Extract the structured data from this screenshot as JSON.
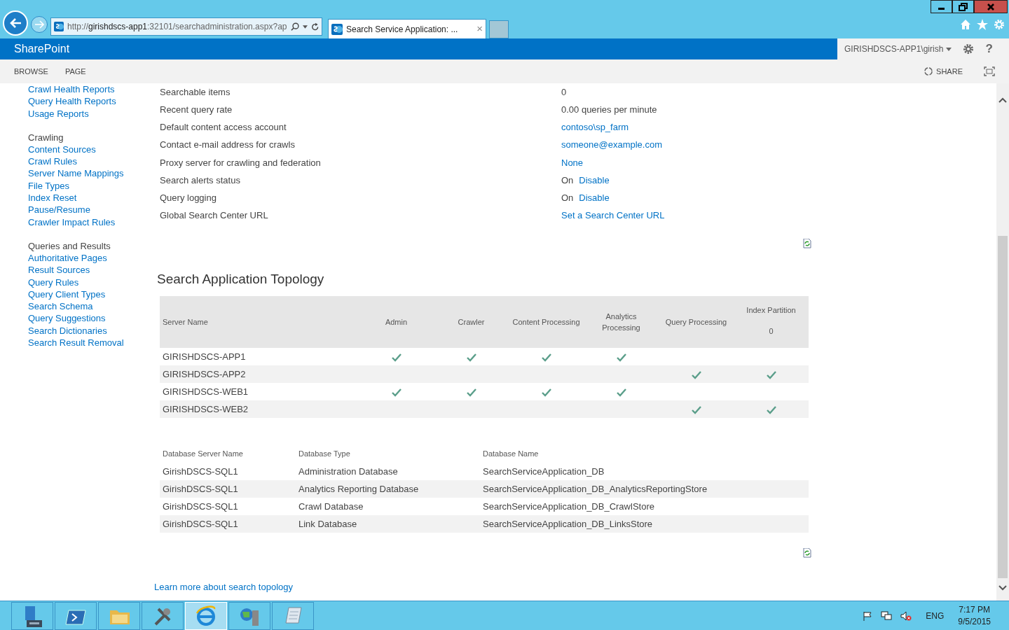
{
  "browser": {
    "address": {
      "scheme": "http://",
      "host": "girishdscs-app1",
      "path": ":32101/searchadministration.aspx?ap"
    },
    "tab": {
      "title": "Search Service Application: ...",
      "close": "×"
    }
  },
  "suite_bar": {
    "brand": "SharePoint",
    "user": "GIRISHDSCS-APP1\\girish",
    "help": "?"
  },
  "ribbon": {
    "tabs": [
      "BROWSE",
      "PAGE"
    ],
    "share": "SHARE"
  },
  "nav": [
    {
      "links": [
        "Crawl Health Reports",
        "Query Health Reports",
        "Usage Reports"
      ]
    },
    {
      "heading": "Crawling",
      "links": [
        "Content Sources",
        "Crawl Rules",
        "Server Name Mappings",
        "File Types",
        "Index Reset",
        "Pause/Resume",
        "Crawler Impact Rules"
      ]
    },
    {
      "heading": "Queries and Results",
      "links": [
        "Authoritative Pages",
        "Result Sources",
        "Query Rules",
        "Query Client Types",
        "Search Schema",
        "Query Suggestions",
        "Search Dictionaries",
        "Search Result Removal"
      ]
    }
  ],
  "status": [
    {
      "label": "Searchable items",
      "kind": "text",
      "value": "0"
    },
    {
      "label": "Recent query rate",
      "kind": "text",
      "value": "0.00 queries per minute"
    },
    {
      "label": "Default content access account",
      "kind": "link",
      "value": "contoso\\sp_farm"
    },
    {
      "label": "Contact e-mail address for crawls",
      "kind": "link",
      "value": "someone@example.com"
    },
    {
      "label": "Proxy server for crawling and federation",
      "kind": "link",
      "value": "None"
    },
    {
      "label": "Search alerts status",
      "kind": "toggle",
      "value": "On",
      "action": "Disable"
    },
    {
      "label": "Query logging",
      "kind": "toggle",
      "value": "On",
      "action": "Disable"
    },
    {
      "label": "Global Search Center URL",
      "kind": "link",
      "value": "Set a Search Center URL"
    }
  ],
  "topology": {
    "title": "Search Application Topology",
    "columns": [
      {
        "label": "Server Name"
      },
      {
        "label": "Admin"
      },
      {
        "label": "Crawler"
      },
      {
        "label": "Content Processing"
      },
      {
        "label": "Analytics Processing"
      },
      {
        "label": "Query Processing"
      },
      {
        "label": "Index Partition",
        "sub": "0"
      }
    ],
    "rows": [
      {
        "name": "GIRISHDSCS-APP1",
        "checks": [
          true,
          true,
          true,
          true,
          false,
          false
        ]
      },
      {
        "name": "GIRISHDSCS-APP2",
        "checks": [
          false,
          false,
          false,
          false,
          true,
          true
        ]
      },
      {
        "name": "GIRISHDSCS-WEB1",
        "checks": [
          true,
          true,
          true,
          true,
          false,
          false
        ]
      },
      {
        "name": "GIRISHDSCS-WEB2",
        "checks": [
          false,
          false,
          false,
          false,
          true,
          true
        ]
      }
    ]
  },
  "databases": {
    "columns": [
      "Database Server Name",
      "Database Type",
      "Database Name"
    ],
    "rows": [
      [
        "GirishDSCS-SQL1",
        "Administration Database",
        "SearchServiceApplication_DB"
      ],
      [
        "GirishDSCS-SQL1",
        "Analytics Reporting Database",
        "SearchServiceApplication_DB_AnalyticsReportingStore"
      ],
      [
        "GirishDSCS-SQL1",
        "Crawl Database",
        "SearchServiceApplication_DB_CrawlStore"
      ],
      [
        "GirishDSCS-SQL1",
        "Link Database",
        "SearchServiceApplication_DB_LinksStore"
      ]
    ]
  },
  "learn_more": "Learn more about search topology",
  "taskbar": {
    "apps": [
      {
        "kind": "server",
        "selected": false
      },
      {
        "kind": "shell",
        "selected": false
      },
      {
        "kind": "folder",
        "selected": false
      },
      {
        "kind": "tools",
        "selected": false
      },
      {
        "kind": "browser",
        "selected": true
      },
      {
        "kind": "globe",
        "selected": false
      },
      {
        "kind": "notepad",
        "selected": false
      }
    ],
    "language": "ENG",
    "time": "7:17 PM",
    "date": "9/5/2015"
  }
}
